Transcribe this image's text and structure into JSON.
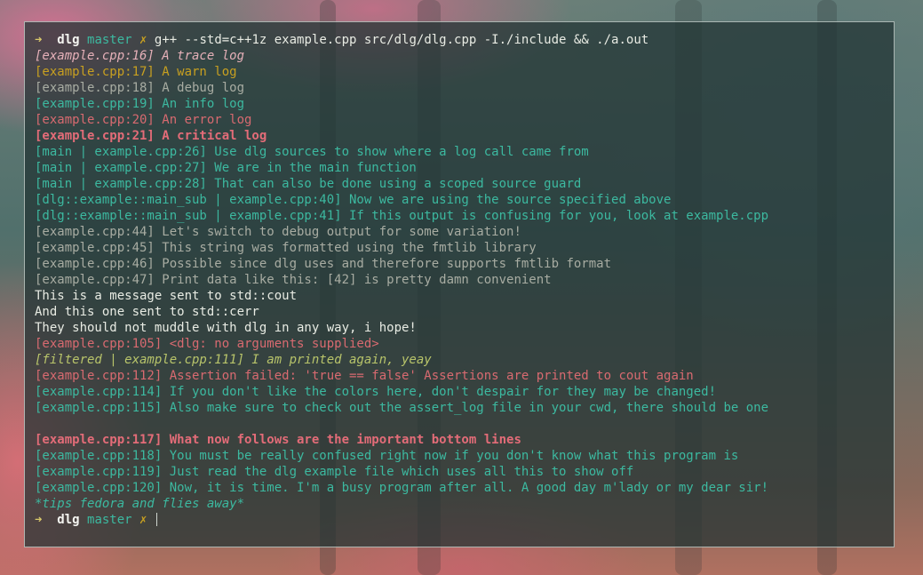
{
  "colors": {
    "trace": "#e5b0b8",
    "warn": "#c8a020",
    "debug": "#a8aca2",
    "info": "#3cb9a0",
    "error": "#d86a70",
    "critical": "#e36c78",
    "plain": "#e8ebe3",
    "prompt_arrow": "#d8c86a",
    "prompt_dir": "#f3f3ef",
    "prompt_branch": "#3cb9a0",
    "prompt_dirty": "#c8a020",
    "italic_green": "#b8c46a"
  },
  "lines": [
    {
      "segments": [
        {
          "text": "➜  ",
          "color": "#d8c86a",
          "bold": true
        },
        {
          "text": "dlg ",
          "color": "#f3f3ef",
          "bold": true
        },
        {
          "text": "master ",
          "color": "#3cb9a0"
        },
        {
          "text": "✗ ",
          "color": "#c8a020"
        },
        {
          "text": "g++ --std=c++1z example.cpp src/dlg/dlg.cpp -I./include && ./a.out",
          "color": "#e8ebe3"
        }
      ]
    },
    {
      "segments": [
        {
          "text": "[example.cpp:16] A trace log",
          "color": "#e5b0b8",
          "italic": true
        }
      ]
    },
    {
      "segments": [
        {
          "text": "[example.cpp:17] A warn log",
          "color": "#c8a020"
        }
      ]
    },
    {
      "segments": [
        {
          "text": "[example.cpp:18] A debug log",
          "color": "#a8aca2"
        }
      ]
    },
    {
      "segments": [
        {
          "text": "[example.cpp:19] An info log",
          "color": "#3cb9a0"
        }
      ]
    },
    {
      "segments": [
        {
          "text": "[example.cpp:20] An error log",
          "color": "#d86a70"
        }
      ]
    },
    {
      "segments": [
        {
          "text": "[example.cpp:21] A critical log",
          "color": "#e36c78",
          "bold": true
        }
      ]
    },
    {
      "segments": [
        {
          "text": "[main | example.cpp:26] Use dlg sources to show where a log call came from",
          "color": "#3cb9a0"
        }
      ]
    },
    {
      "segments": [
        {
          "text": "[main | example.cpp:27] We are in the main function",
          "color": "#3cb9a0"
        }
      ]
    },
    {
      "segments": [
        {
          "text": "[main | example.cpp:28] That can also be done using a scoped source guard",
          "color": "#3cb9a0"
        }
      ]
    },
    {
      "segments": [
        {
          "text": "[dlg::example::main_sub | example.cpp:40] Now we are using the source specified above",
          "color": "#3cb9a0"
        }
      ]
    },
    {
      "segments": [
        {
          "text": "[dlg::example::main_sub | example.cpp:41] If this output is confusing for you, look at example.cpp",
          "color": "#3cb9a0"
        }
      ]
    },
    {
      "segments": [
        {
          "text": "[example.cpp:44] Let's switch to debug output for some variation!",
          "color": "#a8aca2"
        }
      ]
    },
    {
      "segments": [
        {
          "text": "[example.cpp:45] This string was formatted using the fmtlib library",
          "color": "#a8aca2"
        }
      ]
    },
    {
      "segments": [
        {
          "text": "[example.cpp:46] Possible since dlg uses and therefore supports fmtlib format",
          "color": "#a8aca2"
        }
      ]
    },
    {
      "segments": [
        {
          "text": "[example.cpp:47] Print data like this: [42] is pretty damn convenient",
          "color": "#a8aca2"
        }
      ]
    },
    {
      "segments": [
        {
          "text": "This is a message sent to std::cout",
          "color": "#e8ebe3"
        }
      ]
    },
    {
      "segments": [
        {
          "text": "And this one sent to std::cerr",
          "color": "#e8ebe3"
        }
      ]
    },
    {
      "segments": [
        {
          "text": "They should not muddle with dlg in any way, i hope!",
          "color": "#e8ebe3"
        }
      ]
    },
    {
      "segments": [
        {
          "text": "[example.cpp:105] <dlg: no arguments supplied>",
          "color": "#d86a70"
        }
      ]
    },
    {
      "segments": [
        {
          "text": "[filtered | example.cpp:111] I am printed again, yeay",
          "color": "#b8c46a",
          "italic": true
        }
      ]
    },
    {
      "segments": [
        {
          "text": "[example.cpp:112] Assertion failed: 'true == false' Assertions are printed to cout again",
          "color": "#d86a70"
        }
      ]
    },
    {
      "segments": [
        {
          "text": "[example.cpp:114] If you don't like the colors here, don't despair for they may be changed!",
          "color": "#3cb9a0"
        }
      ]
    },
    {
      "segments": [
        {
          "text": "[example.cpp:115] Also make sure to check out the assert_log file in your cwd, there should be one",
          "color": "#3cb9a0"
        }
      ]
    },
    {
      "segments": [
        {
          "text": "",
          "color": "#e8ebe3"
        }
      ]
    },
    {
      "segments": [
        {
          "text": "[example.cpp:117] What now follows are the important bottom lines",
          "color": "#e36c78",
          "bold": true
        }
      ]
    },
    {
      "segments": [
        {
          "text": "[example.cpp:118] You must be really confused right now if you don't know what this program is",
          "color": "#3cb9a0"
        }
      ]
    },
    {
      "segments": [
        {
          "text": "[example.cpp:119] Just read the dlg example file which uses all this to show off",
          "color": "#3cb9a0"
        }
      ]
    },
    {
      "segments": [
        {
          "text": "[example.cpp:120] Now, it is time. I'm a busy program after all. A good day m'lady or my dear sir!",
          "color": "#3cb9a0"
        }
      ]
    },
    {
      "segments": [
        {
          "text": "*tips fedora and flies away*",
          "color": "#3cb9a0",
          "italic": true
        }
      ]
    },
    {
      "segments": [
        {
          "text": "➜  ",
          "color": "#d8c86a",
          "bold": true
        },
        {
          "text": "dlg ",
          "color": "#f3f3ef",
          "bold": true
        },
        {
          "text": "master ",
          "color": "#3cb9a0"
        },
        {
          "text": "✗ ",
          "color": "#c8a020"
        }
      ],
      "cursor": true
    }
  ]
}
